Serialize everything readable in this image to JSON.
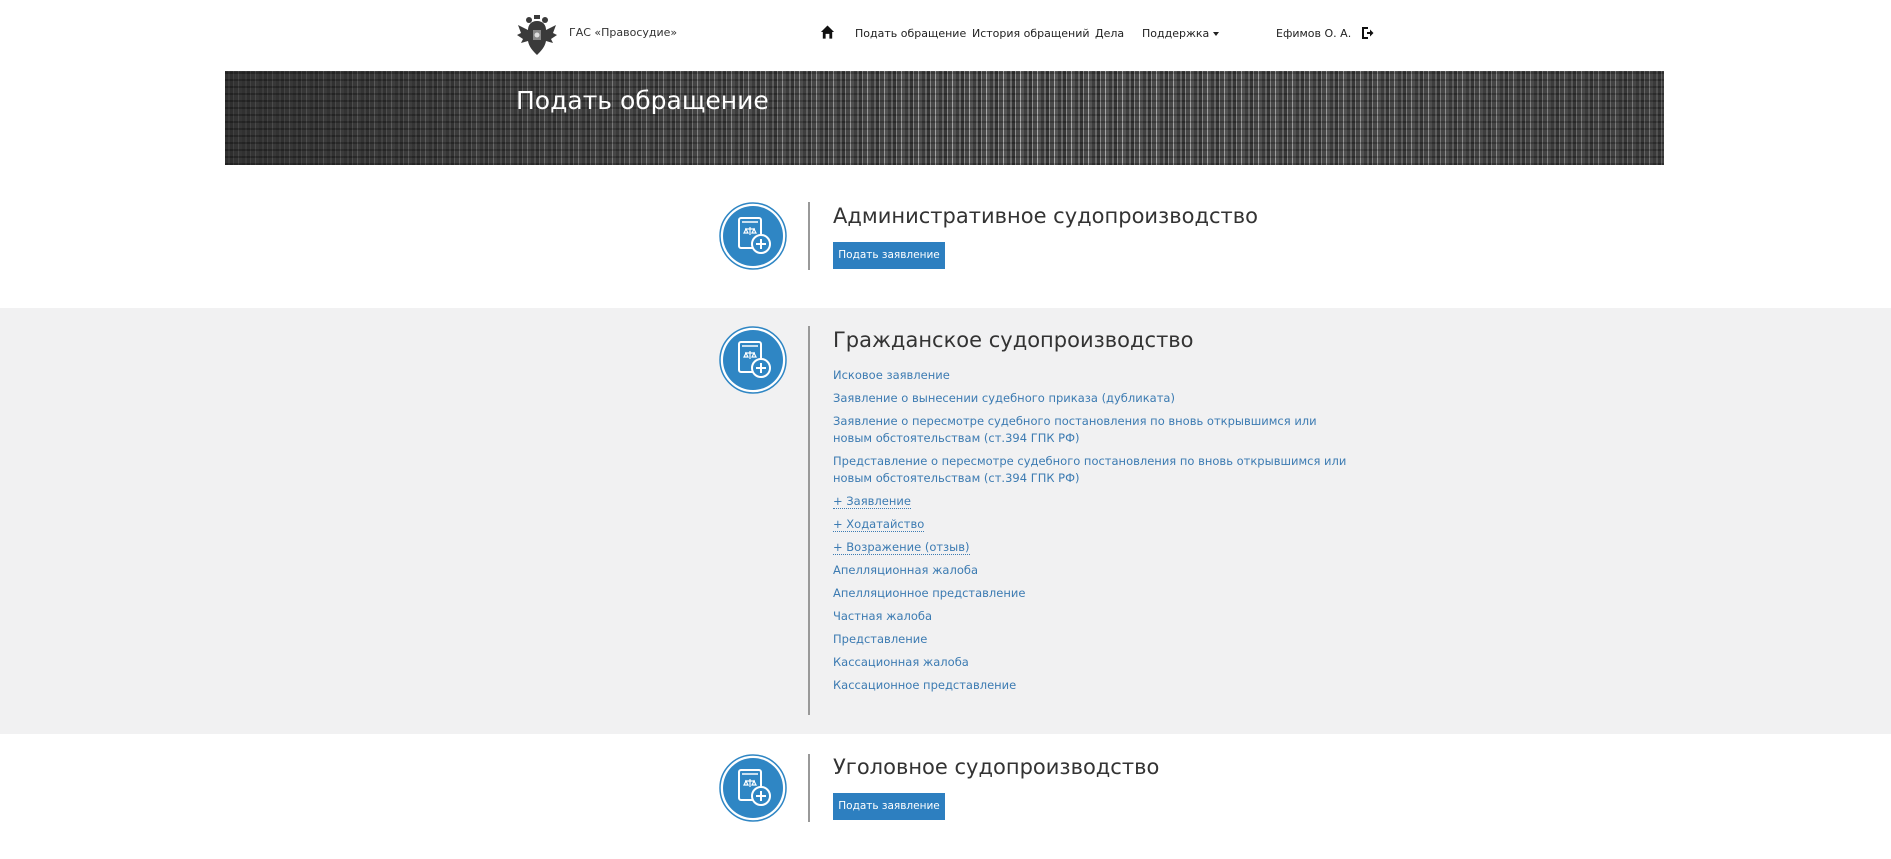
{
  "header": {
    "logo_text": "ГАС «Правосудие»",
    "nav": {
      "home_icon": "home-icon",
      "submit": "Подать обращение",
      "history": "История обращений",
      "cases": "Дела",
      "support": "Поддержка"
    },
    "user": "Ефимов О. А.",
    "logout_icon": "logout-icon"
  },
  "banner": {
    "title": "Подать обращение"
  },
  "sections": [
    {
      "title": "Административное судопроизводство",
      "icon": "document-plus-icon",
      "button": "Подать заявление"
    },
    {
      "title": "Гражданское судопроизводство",
      "icon": "document-plus-icon",
      "links": [
        "Исковое заявление",
        "Заявление о вынесении судебного приказа (дубликата)",
        "Заявление о пересмотре судебного постановления по вновь открывшимся или новым обстоятельствам (ст.394 ГПК РФ)",
        "Представление о пересмотре судебного постановления по вновь открывшимся или новым обстоятельствам (ст.394 ГПК РФ)",
        "+ Заявление",
        "+ Ходатайство",
        "+ Возражение (отзыв)",
        "Апелляционная жалоба",
        "Апелляционное представление",
        "Частная жалоба",
        "Представление",
        "Кассационная жалоба",
        "Кассационное представление"
      ]
    },
    {
      "title": "Уголовное судопроизводство",
      "icon": "document-plus-icon",
      "button": "Подать заявление"
    }
  ],
  "colors": {
    "accent": "#2d7fc0",
    "link": "#3c7bb2",
    "icon_circle": "#2f86c4",
    "section_gray": "#f1f1f2"
  }
}
